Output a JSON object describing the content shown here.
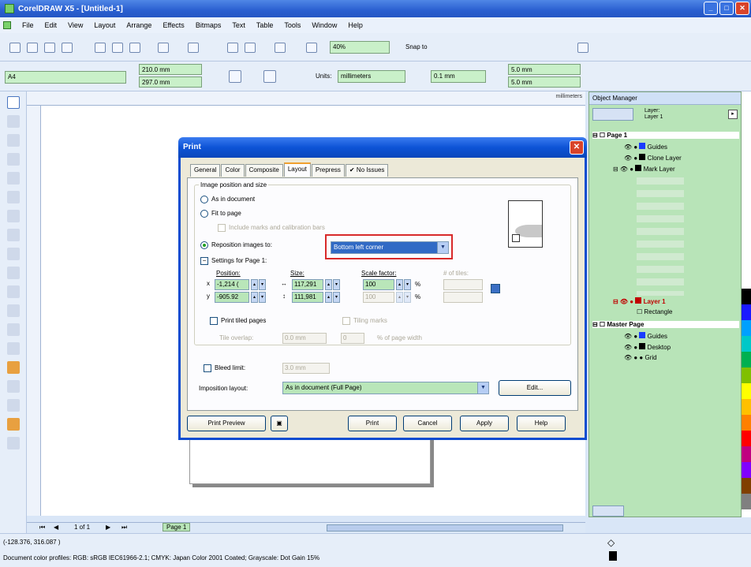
{
  "app": {
    "title": "CorelDRAW X5 - [Untitled-1]"
  },
  "menu": [
    "File",
    "Edit",
    "View",
    "Layout",
    "Arrange",
    "Effects",
    "Bitmaps",
    "Text",
    "Table",
    "Tools",
    "Window",
    "Help"
  ],
  "toolbar": {
    "zoom": "40%",
    "snap": "Snap to"
  },
  "propbar": {
    "paper": "A4",
    "width": "210.0 mm",
    "height": "297.0 mm",
    "units_label": "Units:",
    "units_value": "millimeters",
    "nudge": "0.1 mm",
    "dup_x": "5.0 mm",
    "dup_y": "5.0 mm"
  },
  "ruler": {
    "units": "millimeters"
  },
  "object_manager": {
    "title": "Object Manager",
    "layer_header": "Layer:",
    "layer_name": "Layer 1",
    "rows": [
      {
        "label": "Page 1",
        "bold": true
      },
      {
        "label": "Guides"
      },
      {
        "label": "Clone Layer"
      },
      {
        "label": "Mark Layer"
      },
      {
        "label": "Layer 1",
        "red": true
      },
      {
        "label": "Rectangle"
      },
      {
        "label": "Master Page",
        "bold": true
      },
      {
        "label": "Guides"
      },
      {
        "label": "Desktop"
      },
      {
        "label": "Grid"
      }
    ]
  },
  "dialog": {
    "title": "Print",
    "tabs": [
      "General",
      "Color",
      "Composite",
      "Layout",
      "Prepress",
      "No Issues"
    ],
    "active_tab": "Layout",
    "group_title": "Image position and size",
    "radio_as_in_document": "As in document",
    "radio_fit_to_page": "Fit to page",
    "include_marks": "Include marks and calibration bars",
    "radio_reposition": "Reposition images to:",
    "reposition_value": "Bottom left corner",
    "settings_for": "Settings for Page 1:",
    "position_label": "Position:",
    "size_label": "Size:",
    "scale_label": "Scale factor:",
    "tiles_label": "# of tiles:",
    "pos_x": "-1,214 (",
    "pos_y": "-905.92",
    "size_w": "117,291",
    "size_h": "111,981",
    "scale_x": "100",
    "scale_y": "100",
    "pct1": "%",
    "pct2": "%",
    "print_tiled": "Print tiled pages",
    "tiling_marks": "Tiling marks",
    "tile_overlap": "Tile overlap:",
    "overlap_value": "0.0 mm",
    "overlap_pct": "0",
    "pct_page_width": "% of page width",
    "bleed_limit": "Bleed limit:",
    "bleed_value": "3.0 mm",
    "imposition_label": "Imposition layout:",
    "imposition_value": "As in document (Full Page)",
    "edit_button": "Edit...",
    "buttons": {
      "preview": "Print Preview",
      "print": "Print",
      "cancel": "Cancel",
      "apply": "Apply",
      "help": "Help"
    }
  },
  "pagebar": {
    "counter": "1 of 1",
    "page_tab": "Page 1"
  },
  "status": {
    "coords": "(-128.376, 316.087 )",
    "profile": "Document color profiles: RGB: sRGB IEC61966-2.1; CMYK: Japan Color 2001 Coated; Grayscale: Dot Gain 15%"
  },
  "palette_colors": [
    "#ffffff",
    "#000000",
    "#1a1aff",
    "#00a0ff",
    "#00c8c8",
    "#00b050",
    "#80c000",
    "#ffff00",
    "#ffc000",
    "#ff8000",
    "#ff0000",
    "#c00080",
    "#8000ff",
    "#804000",
    "#808080"
  ]
}
